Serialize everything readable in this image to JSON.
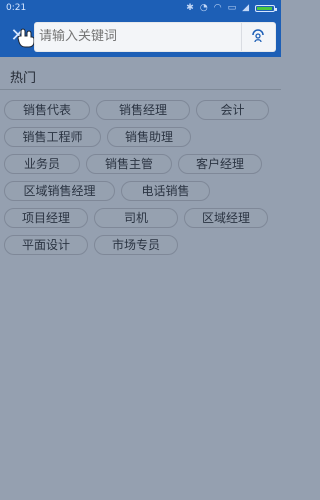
{
  "status_bar": {
    "time": "0:21",
    "signal_text": "...",
    "battery_label": ""
  },
  "search": {
    "placeholder": "请输入关键词"
  },
  "hot": {
    "title": "热门",
    "tags": [
      "销售代表",
      "销售经理",
      "会计",
      "销售工程师",
      "销售助理",
      "业务员",
      "销售主管",
      "客户经理",
      "区域销售经理",
      "电话销售",
      "项目经理",
      "司机",
      "区域经理",
      "平面设计",
      "市场专员"
    ]
  },
  "icons": {
    "close": "close-icon",
    "voice": "voice-search-icon",
    "battery": "battery-icon",
    "wifi": "wifi-icon",
    "bluetooth": "bluetooth-icon",
    "alarm": "alarm-icon",
    "signal": "signal-icon"
  },
  "colors": {
    "header": "#1d5fb6",
    "overlay": "#95a0b0",
    "tag_border": "#7f8898"
  }
}
